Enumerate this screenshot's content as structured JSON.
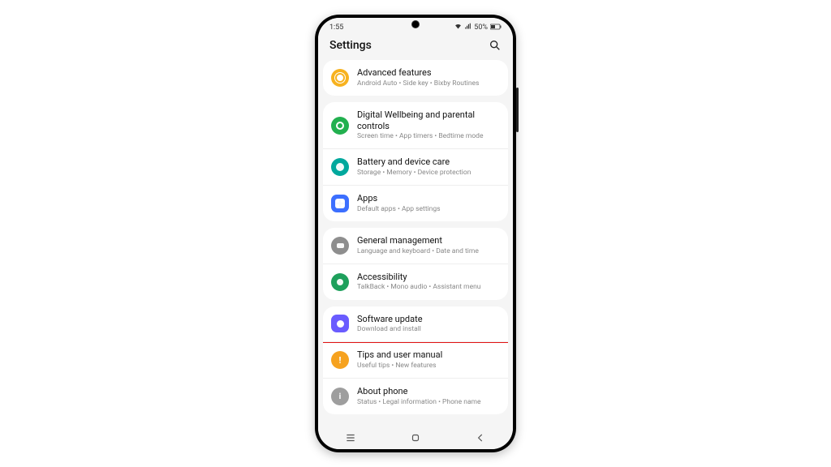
{
  "statusbar": {
    "time": "1:55",
    "battery": "50%"
  },
  "header": {
    "title": "Settings"
  },
  "groups": [
    {
      "items": [
        {
          "key": "advanced",
          "title": "Advanced features",
          "sub": "Android Auto  •  Side key  •  Bixby Routines"
        }
      ]
    },
    {
      "items": [
        {
          "key": "wellbeing",
          "title": "Digital Wellbeing and parental controls",
          "sub": "Screen time  •  App timers  •  Bedtime mode"
        },
        {
          "key": "battery",
          "title": "Battery and device care",
          "sub": "Storage  •  Memory  •  Device protection"
        },
        {
          "key": "apps",
          "title": "Apps",
          "sub": "Default apps  •  App settings"
        }
      ]
    },
    {
      "items": [
        {
          "key": "general",
          "title": "General management",
          "sub": "Language and keyboard  •  Date and time"
        },
        {
          "key": "access",
          "title": "Accessibility",
          "sub": "TalkBack  •  Mono audio  •  Assistant menu"
        }
      ]
    },
    {
      "items": [
        {
          "key": "software",
          "title": "Software update",
          "sub": "Download and install",
          "highlight": true
        },
        {
          "key": "tips",
          "title": "Tips and user manual",
          "sub": "Useful tips  •  New features"
        },
        {
          "key": "about",
          "title": "About phone",
          "sub": "Status  •  Legal information  •  Phone name"
        }
      ]
    }
  ]
}
